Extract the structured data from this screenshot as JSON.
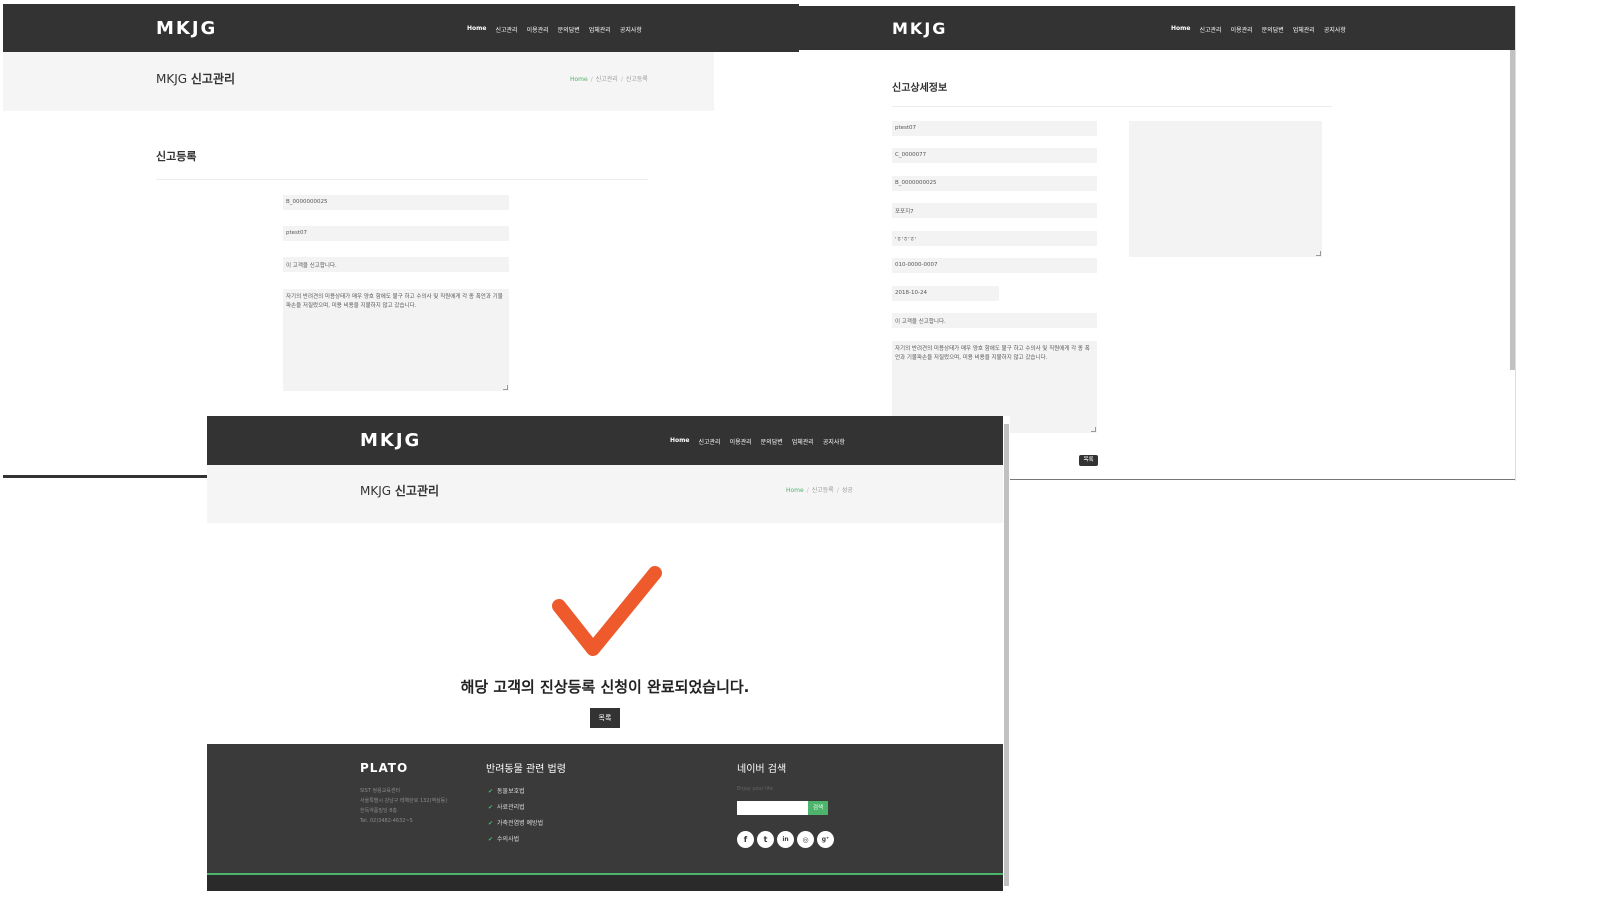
{
  "brand": "MKJG",
  "nav": [
    "Home",
    "신고관리",
    "이용관리",
    "문의답변",
    "업체관리",
    "공지사항"
  ],
  "shot1": {
    "banner_prefix": "MKJG",
    "banner_title": "신고관리",
    "breadcrumb": [
      "Home",
      "신고관리",
      "신고등록"
    ],
    "section_title": "신고등록",
    "fields": [
      "B_0000000025",
      "ptest07",
      "이 고객을 신고합니다."
    ],
    "content": "자기의 반려견의 미용상태가 매우 양호 함에도 불구 하고 수의사 및 직원에게 각 종 폭언과 기물파손을 저질렀으며, 미용 비용을 지불하지 않고 갔습니다."
  },
  "shot2": {
    "section_title": "신고상세정보",
    "fields": [
      "ptest07",
      "C_0000077",
      "B_0000000025",
      "포포지7",
      "'ㅎ'ㅎ'ㅎ'",
      "010-0000-0007",
      "2018-10-24",
      "이 고객을 신고합니다."
    ],
    "content": "자기의 반려견의 미용상태가 매우 양호 함에도 불구 하고 수의사 및 직원에게 각 종 폭언과 기물파손을 저질렀으며, 미용 비용을 지불하지 않고 갔습니다.",
    "list_button": "목록"
  },
  "shot3": {
    "banner_prefix": "MKJG",
    "banner_title": "신고관리",
    "breadcrumb": [
      "Home",
      "신고등록",
      "성공"
    ],
    "message": "해당 고객의 진상등록 신청이 완료되었습니다.",
    "list_button": "목록",
    "footer": {
      "brand": "PLATO",
      "address_lines": [
        "SIST 쌍용교육센터",
        "서울특별시 강남구 테헤란로 132(역삼동)",
        "한독약품빌딩 8층",
        "Tel. 02)3482-4632~5"
      ],
      "law_title": "반려동물 관련 법령",
      "laws": [
        "동물보호법",
        "사료관리법",
        "가축전염병 예방법",
        "수의사법"
      ],
      "search_title": "네이버 검색",
      "search_tagline": "Enjoy your life",
      "search_button": "검색",
      "social_icons": [
        "facebook-icon",
        "twitter-icon",
        "linkedin-icon",
        "dribbble-icon",
        "google-plus-icon"
      ],
      "social_glyphs": [
        "f",
        "t",
        "in",
        "◎",
        "g⁺"
      ]
    }
  },
  "colors": {
    "dark": "#333333",
    "accent": "#4db46b",
    "check": "#ee5a2c",
    "banner": "#f5f5f5",
    "field": "#f3f3f3"
  }
}
